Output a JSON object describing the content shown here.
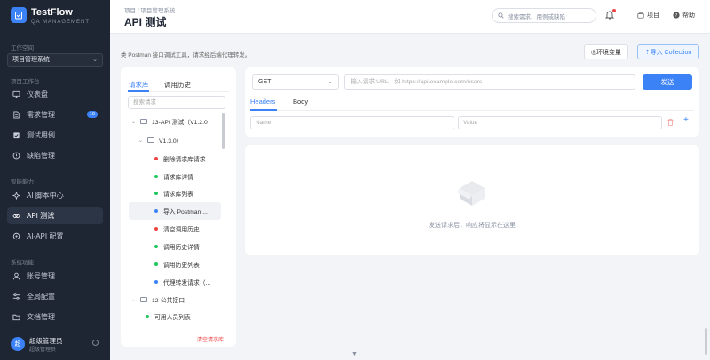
{
  "app": {
    "name": "TestFlow",
    "subtitle": "QA MANAGEMENT"
  },
  "sidebar": {
    "workspace_label": "工作空间",
    "workspace_value": "项目管理系统",
    "section_project": "项目工作台",
    "section_ai": "智能能力",
    "section_system": "系统功能",
    "items": [
      {
        "label": "仪表盘",
        "icon": "monitor-icon"
      },
      {
        "label": "需求管理",
        "icon": "document-icon",
        "badge": "16"
      },
      {
        "label": "测试用例",
        "icon": "clipboard-icon"
      },
      {
        "label": "缺陷管理",
        "icon": "bug-icon"
      },
      {
        "label": "AI 脚本中心",
        "icon": "sparkle-icon"
      },
      {
        "label": "API 测试",
        "icon": "api-icon",
        "active": true
      },
      {
        "label": "AI-API 配置",
        "icon": "gear-icon"
      },
      {
        "label": "账号管理",
        "icon": "user-icon"
      },
      {
        "label": "全局配置",
        "icon": "sliders-icon"
      },
      {
        "label": "文档管理",
        "icon": "folder-icon"
      }
    ],
    "user": {
      "avatar": "超",
      "name": "超级管理员",
      "role": "超级管理员"
    }
  },
  "header": {
    "breadcrumb": "项目 / 项目管理系统",
    "title": "API 测试",
    "search_placeholder": "搜索需求、用例或缺陷",
    "project_link": "项目",
    "help_link": "帮助"
  },
  "page": {
    "description": "类 Postman 接口调试工具，请求经后端代理转发。",
    "env_button": "◎环境变量",
    "import_button": "⇡导入 Collection"
  },
  "left_panel": {
    "tabs": [
      "请求库",
      "调用历史"
    ],
    "search_placeholder": "搜索请求",
    "tree": [
      {
        "type": "folder",
        "label": "13-API 测试（V1.2.0",
        "level": 0
      },
      {
        "type": "folder",
        "label": "V1.3.0）",
        "level": 1
      },
      {
        "type": "request",
        "label": "删除请求库请求",
        "method_color": "#ef4444",
        "level": 2
      },
      {
        "type": "request",
        "label": "请求库详情",
        "method_color": "#22c55e",
        "level": 2
      },
      {
        "type": "request",
        "label": "请求库列表",
        "method_color": "#22c55e",
        "level": 2
      },
      {
        "type": "request",
        "label": "导入 Postman ...",
        "method_color": "#3b82f6",
        "level": 2,
        "selected": true
      },
      {
        "type": "request",
        "label": "清空调用历史",
        "method_color": "#ef4444",
        "level": 2
      },
      {
        "type": "request",
        "label": "调用历史详情",
        "method_color": "#22c55e",
        "level": 2
      },
      {
        "type": "request",
        "label": "调用历史列表",
        "method_color": "#22c55e",
        "level": 2
      },
      {
        "type": "request",
        "label": "代理转发请求（...",
        "method_color": "#3b82f6",
        "level": 2
      },
      {
        "type": "folder",
        "label": "12-公共接口",
        "level": 0
      },
      {
        "type": "request",
        "label": "可用人员列表",
        "method_color": "#22c55e",
        "level": 1
      }
    ],
    "clear_label": "清空请求库"
  },
  "request": {
    "method": "GET",
    "url_placeholder": "输入请求 URL，如 https://api.example.com/users",
    "send_label": "发送",
    "tabs": [
      "Headers",
      "Body"
    ],
    "name_placeholder": "Name",
    "value_placeholder": "Value",
    "add_symbol": "+"
  },
  "response": {
    "empty_text": "发送请求后，响应将显示在这里"
  },
  "colors": {
    "accent": "#3b82f6",
    "sidebar": "#1f2633"
  }
}
